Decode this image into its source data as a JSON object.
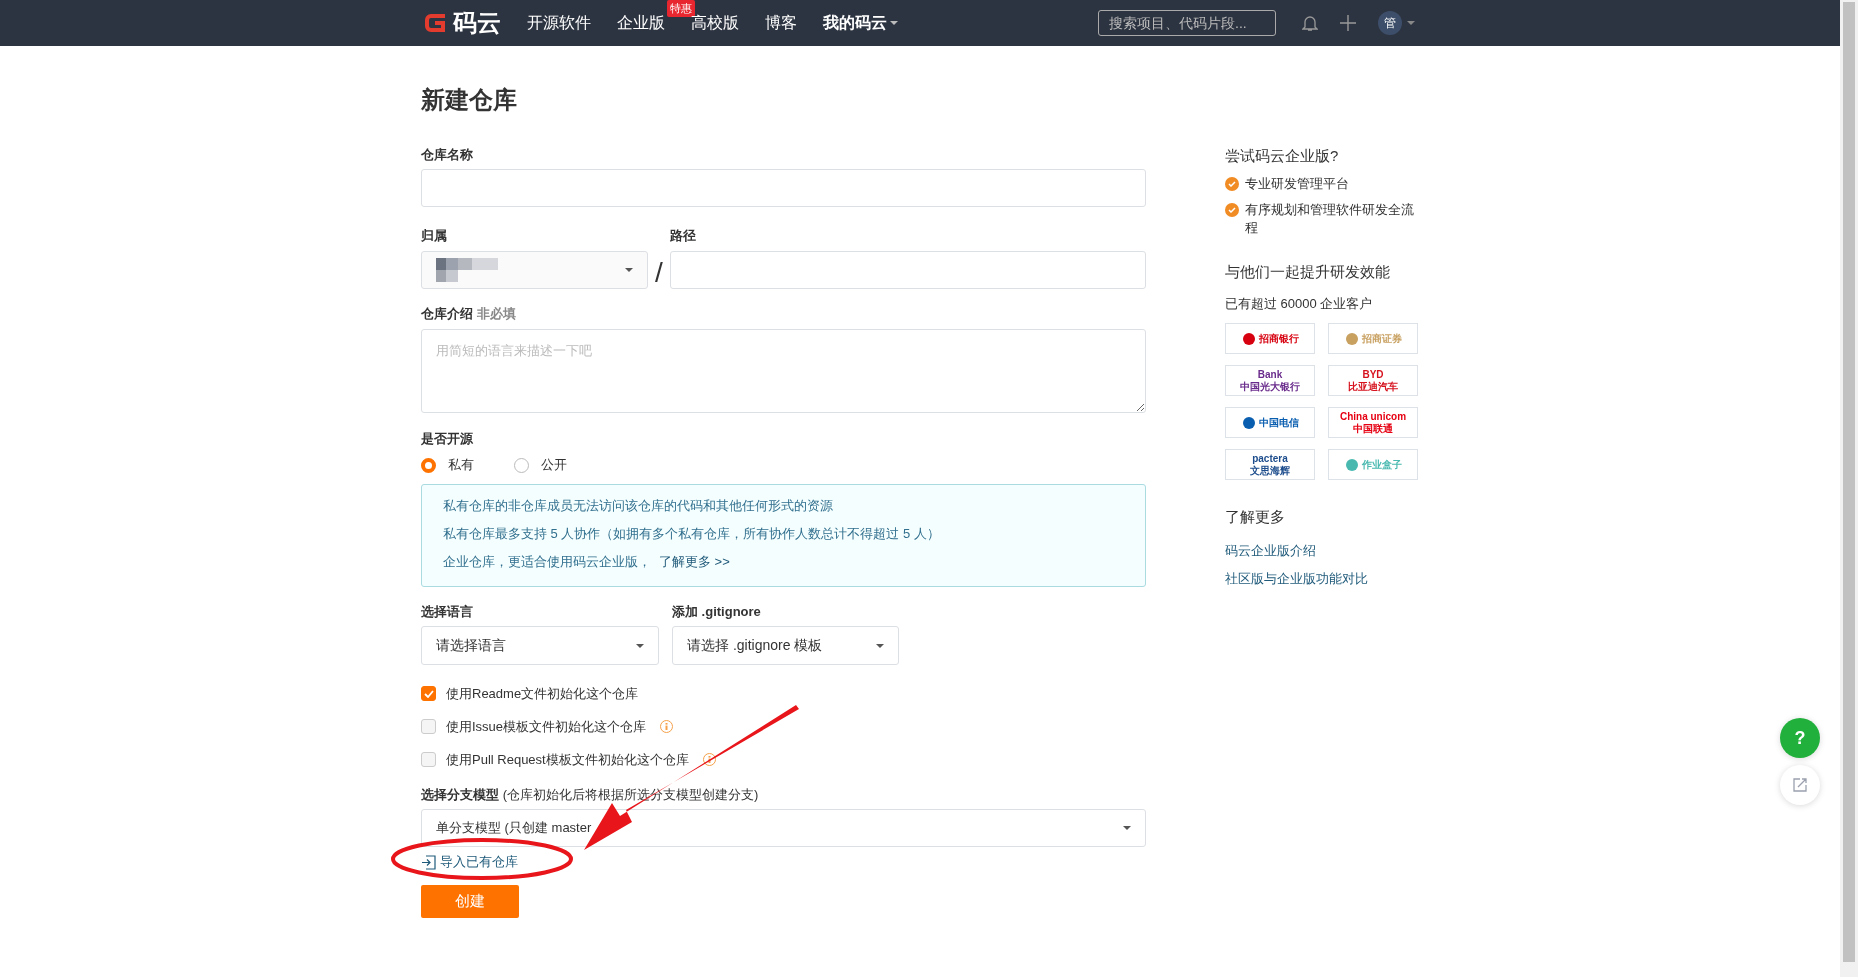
{
  "nav": {
    "logo": "码云",
    "items": [
      {
        "label": "开源软件",
        "kind": "link"
      },
      {
        "label": "企业版",
        "kind": "link",
        "badge": "特惠"
      },
      {
        "label": "高校版",
        "kind": "link"
      },
      {
        "label": "博客",
        "kind": "link"
      },
      {
        "label": "我的码云",
        "kind": "dropdown"
      }
    ],
    "search": {
      "placeholder": "搜索项目、代码片段..."
    },
    "avatar": "管"
  },
  "page_title": "新建仓库",
  "name_field": {
    "label": "仓库名称"
  },
  "owner_field": {
    "label": "归属"
  },
  "separator": "/",
  "path_field": {
    "label": "路径"
  },
  "description_field": {
    "label": "仓库介绍",
    "hint": "非必填",
    "placeholder": "用简短的语言来描述一下吧"
  },
  "visibility": {
    "label": "是否开源",
    "options": [
      {
        "label": "私有",
        "selected": true
      },
      {
        "label": "公开",
        "selected": false
      }
    ]
  },
  "notice": {
    "lines": [
      "私有仓库的非仓库成员无法访问该仓库的代码和其他任何形式的资源",
      "私有仓库最多支持 5 人协作（如拥有多个私有仓库，所有协作人数总计不得超过 5 人）"
    ],
    "last_line": "企业仓库，更适合使用码云企业版，",
    "link": "了解更多 >>"
  },
  "language_select": {
    "label": "选择语言",
    "value": "请选择语言"
  },
  "gitignore_select": {
    "label": "添加 .gitignore",
    "value": "请选择 .gitignore 模板"
  },
  "options": [
    {
      "label": "使用Readme文件初始化这个仓库",
      "checked": true,
      "info": false
    },
    {
      "label": "使用Issue模板文件初始化这个仓库",
      "checked": false,
      "info": true
    },
    {
      "label": "使用Pull Request模板文件初始化这个仓库",
      "checked": false,
      "info": true
    }
  ],
  "branch_model": {
    "label": "选择分支模型",
    "note": "(仓库初始化后将根据所选分支模型创建分支)",
    "value": "单分支模型 (只创建 master"
  },
  "import_link": "导入已有仓库",
  "submit": "创建",
  "sidebar": {
    "promo_title": "尝试码云企业版?",
    "promo_items": [
      "专业研发管理平台",
      "有序规划和管理软件研发全流程"
    ],
    "customers_title": "与他们一起提升研发效能",
    "customers_count": "已有超过 60000 企业客户",
    "logos": [
      {
        "text": "招商银行",
        "color": "#d7000f"
      },
      {
        "text": "招商证券",
        "color": "#c8a060"
      },
      {
        "mark": "Bank",
        "text": "中国光大银行",
        "color": "#6a2c8c"
      },
      {
        "mark": "BYD",
        "text": "比亚迪汽车",
        "color": "#d6121e"
      },
      {
        "text": "中国电信",
        "color": "#0a5eb0"
      },
      {
        "mark": "China unicom",
        "text": "中国联通",
        "color": "#e60012"
      },
      {
        "mark": "pactera",
        "text": "文思海辉",
        "color": "#1d4d8c"
      },
      {
        "text": "作业盒子",
        "color": "#49b9b0"
      }
    ],
    "more_title": "了解更多",
    "more_links": [
      "码云企业版介绍",
      "社区版与企业版功能对比"
    ]
  },
  "annotation": {
    "kind": "arrow_ellipse"
  },
  "help_button": "?"
}
